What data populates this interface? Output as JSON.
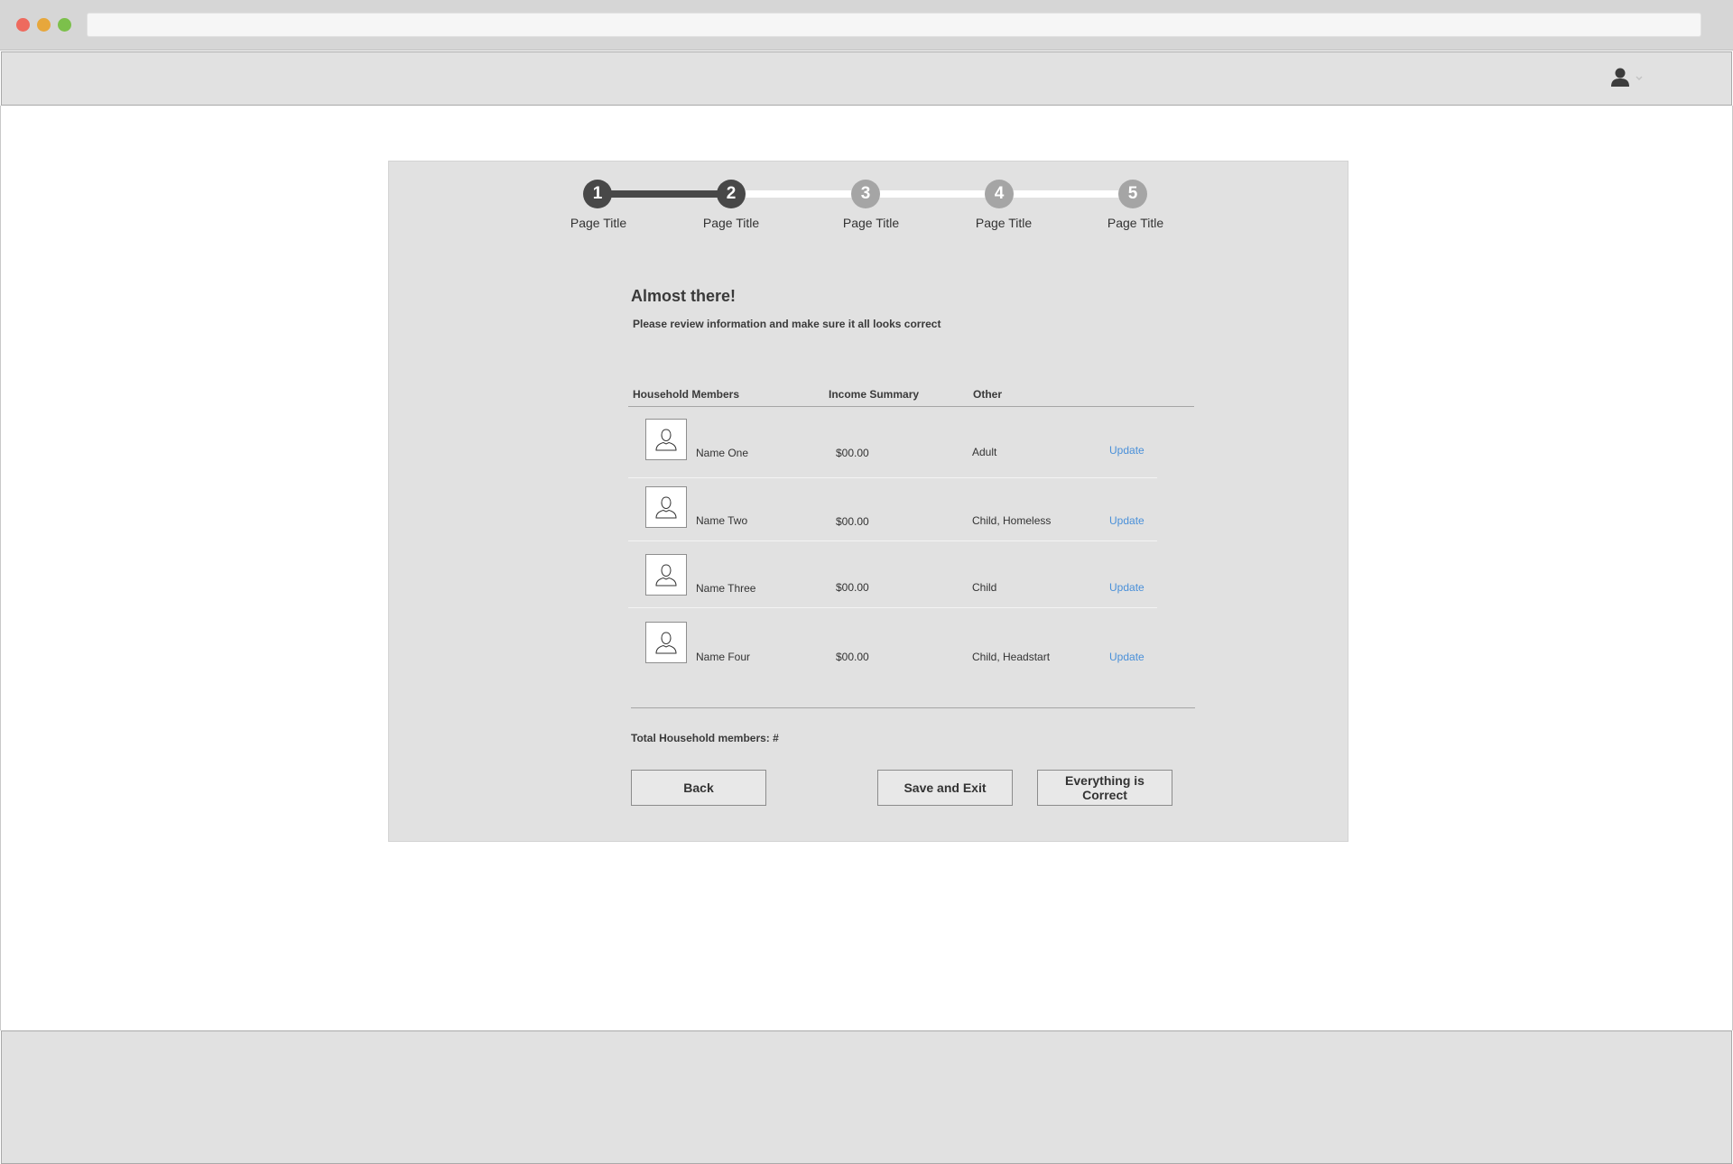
{
  "stepper": {
    "steps": [
      {
        "number": "1",
        "label": "Page Title",
        "state": "complete"
      },
      {
        "number": "2",
        "label": "Page Title",
        "state": "current"
      },
      {
        "number": "3",
        "label": "Page Title",
        "state": "upcoming"
      },
      {
        "number": "4",
        "label": "Page Title",
        "state": "upcoming"
      },
      {
        "number": "5",
        "label": "Page Title",
        "state": "upcoming"
      }
    ]
  },
  "review": {
    "title": "Almost there!",
    "subtitle": "Please review information and make sure it all looks correct",
    "columns": {
      "members": "Household Members",
      "income": "Income Summary",
      "other": "Other"
    },
    "rows": [
      {
        "name": "Name One",
        "income": "$00.00",
        "other": "Adult",
        "action": "Update"
      },
      {
        "name": "Name Two",
        "income": "$00.00",
        "other": "Child, Homeless",
        "action": "Update"
      },
      {
        "name": "Name Three",
        "income": "$00.00",
        "other": "Child",
        "action": "Update"
      },
      {
        "name": "Name Four",
        "income": "$00.00",
        "other": "Child, Headstart",
        "action": "Update"
      }
    ],
    "total": "Total Household members: #"
  },
  "buttons": {
    "back": "Back",
    "save_exit": "Save and Exit",
    "confirm": "Everything is Correct"
  },
  "colors": {
    "link": "#4a90d9",
    "step_active": "#484848",
    "step_inactive": "#a5a5a5",
    "panel": "#e1e1e1"
  },
  "icons": {
    "user_menu": "user-icon",
    "avatar": "person-silhouette-icon"
  }
}
